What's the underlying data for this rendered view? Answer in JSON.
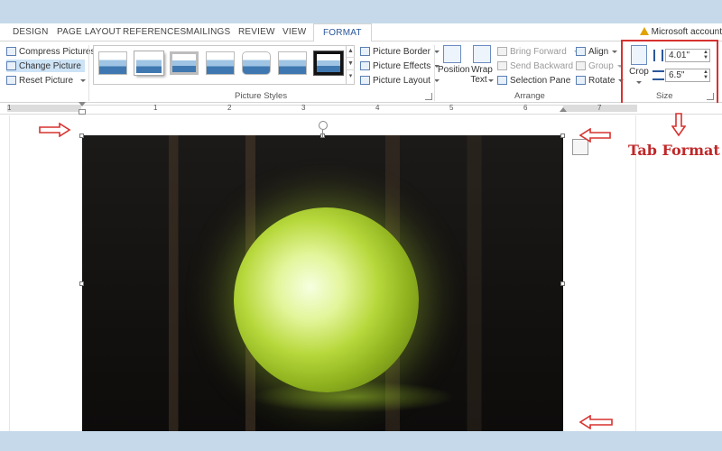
{
  "tabs": [
    {
      "label": "DESIGN"
    },
    {
      "label": "PAGE LAYOUT"
    },
    {
      "label": "REFERENCES"
    },
    {
      "label": "MAILINGS"
    },
    {
      "label": "REVIEW"
    },
    {
      "label": "VIEW"
    },
    {
      "label": "FORMAT"
    }
  ],
  "active_tab": "FORMAT",
  "account": "Microsoft account",
  "adjust": {
    "compress": "Compress Pictures",
    "change": "Change Picture",
    "reset": "Reset Picture"
  },
  "picture_styles": {
    "group_label": "Picture Styles",
    "border": "Picture Border",
    "effects": "Picture Effects",
    "layout": "Picture Layout"
  },
  "arrange": {
    "group_label": "Arrange",
    "position": "Position",
    "wrap_line1": "Wrap",
    "wrap_line2": "Text",
    "bring_forward": "Bring Forward",
    "send_backward": "Send Backward",
    "selection_pane": "Selection Pane",
    "align": "Align",
    "group": "Group",
    "rotate": "Rotate"
  },
  "size": {
    "group_label": "Size",
    "crop": "Crop",
    "height": "4.01\"",
    "width": "6.5\""
  },
  "ruler": {
    "numbers": [
      "1",
      "1",
      "2",
      "3",
      "4",
      "5",
      "6",
      "7"
    ]
  },
  "annotation": "Tab Format",
  "colors": {
    "accent": "#2b579a",
    "annotation_red": "#c0282a",
    "highlight_red": "#d6322f",
    "background": "#c5d9ea"
  }
}
